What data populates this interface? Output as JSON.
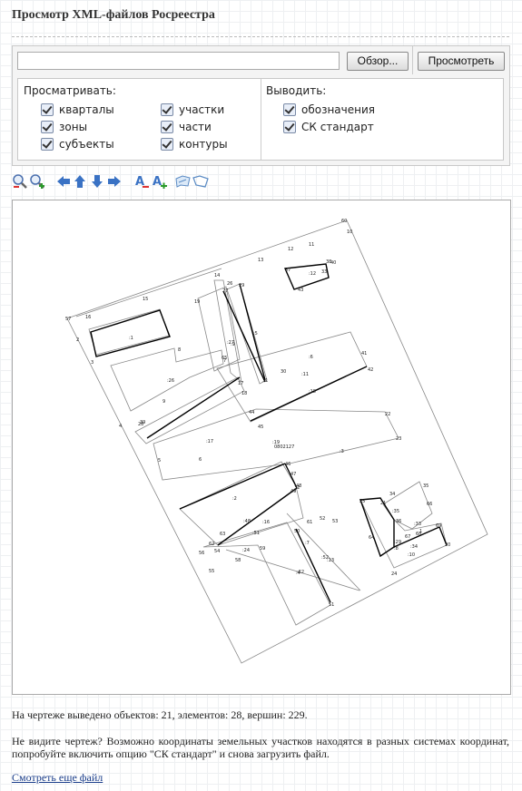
{
  "page": {
    "title": "Просмотр XML-файлов Росреестра"
  },
  "form": {
    "browse_label": "Обзор...",
    "view_label": "Просмотреть",
    "file_value": ""
  },
  "options": {
    "view_title": "Просматривать:",
    "view_items": [
      "кварталы",
      "зоны",
      "субъекты",
      "участки",
      "части",
      "контуры"
    ],
    "output_title": "Выводить:",
    "output_items": [
      "обозначения",
      "СК стандарт"
    ],
    "all_checked": true
  },
  "toolbar": [
    "zoom-out-icon",
    "zoom-in-icon",
    "arrow-left-icon",
    "arrow-up-icon",
    "arrow-down-icon",
    "arrow-right-icon",
    "label-remove-icon",
    "label-add-icon",
    "map-print-icon",
    "map-icon"
  ],
  "drawing": {
    "labels": [
      "60",
      "10",
      "11",
      "12",
      "13",
      "14",
      "15",
      "16",
      "57",
      "2",
      "3",
      "4",
      "5",
      "6",
      "7",
      "8",
      "9",
      "19",
      "22",
      "23",
      "24",
      "25",
      "27",
      "29",
      "41",
      "42",
      "44",
      "45",
      "46",
      "47",
      "48",
      "49",
      "50",
      "51",
      "52",
      "53",
      "54",
      "55",
      "56",
      "58",
      "59",
      "61",
      "62",
      "63",
      "64",
      "65",
      "66",
      "67",
      "68",
      "69",
      "20",
      "21",
      "17",
      "18",
      "26",
      "28",
      "30",
      "31",
      "32",
      "33",
      "34",
      "35",
      "36",
      "37",
      "38",
      "39",
      "40",
      "43",
      "1",
      "0802127",
      ":1",
      ":2",
      ":3",
      ":4",
      ":5",
      ":6",
      ":7",
      ":8",
      ":9",
      ":10",
      ":11",
      ":12",
      ":13",
      ":15",
      ":16",
      ":17",
      ":19",
      ":22",
      ":24",
      ":26",
      ":27",
      ":29",
      ":33",
      ":34",
      ":35",
      ":48",
      ":51",
      ":52",
      ":53"
    ]
  },
  "info": {
    "stats": "На чертеже выведено объектов: 21, элементов: 28, вершин: 229.",
    "hint": "Не видите чертеж? Возможно координаты земельных участков находятся в разных системах координат, попробуйте включить опцию \"СК стандарт\" и снова загрузить файл.",
    "more_link": "Смотреть еще файл"
  }
}
